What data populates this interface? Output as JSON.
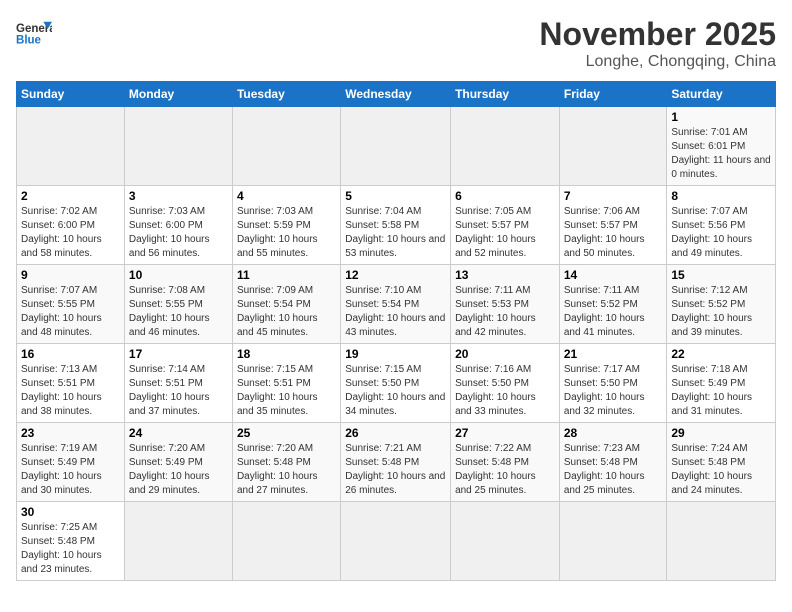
{
  "header": {
    "title": "November 2025",
    "location": "Longhe, Chongqing, China"
  },
  "calendar": {
    "headers": [
      "Sunday",
      "Monday",
      "Tuesday",
      "Wednesday",
      "Thursday",
      "Friday",
      "Saturday"
    ],
    "rows": [
      [
        {
          "day": "",
          "info": ""
        },
        {
          "day": "",
          "info": ""
        },
        {
          "day": "",
          "info": ""
        },
        {
          "day": "",
          "info": ""
        },
        {
          "day": "",
          "info": ""
        },
        {
          "day": "",
          "info": ""
        },
        {
          "day": "1",
          "info": "Sunrise: 7:01 AM\nSunset: 6:01 PM\nDaylight: 11 hours and 0 minutes."
        }
      ],
      [
        {
          "day": "2",
          "info": "Sunrise: 7:02 AM\nSunset: 6:00 PM\nDaylight: 10 hours and 58 minutes."
        },
        {
          "day": "3",
          "info": "Sunrise: 7:03 AM\nSunset: 6:00 PM\nDaylight: 10 hours and 56 minutes."
        },
        {
          "day": "4",
          "info": "Sunrise: 7:03 AM\nSunset: 5:59 PM\nDaylight: 10 hours and 55 minutes."
        },
        {
          "day": "5",
          "info": "Sunrise: 7:04 AM\nSunset: 5:58 PM\nDaylight: 10 hours and 53 minutes."
        },
        {
          "day": "6",
          "info": "Sunrise: 7:05 AM\nSunset: 5:57 PM\nDaylight: 10 hours and 52 minutes."
        },
        {
          "day": "7",
          "info": "Sunrise: 7:06 AM\nSunset: 5:57 PM\nDaylight: 10 hours and 50 minutes."
        },
        {
          "day": "8",
          "info": "Sunrise: 7:07 AM\nSunset: 5:56 PM\nDaylight: 10 hours and 49 minutes."
        }
      ],
      [
        {
          "day": "9",
          "info": "Sunrise: 7:07 AM\nSunset: 5:55 PM\nDaylight: 10 hours and 48 minutes."
        },
        {
          "day": "10",
          "info": "Sunrise: 7:08 AM\nSunset: 5:55 PM\nDaylight: 10 hours and 46 minutes."
        },
        {
          "day": "11",
          "info": "Sunrise: 7:09 AM\nSunset: 5:54 PM\nDaylight: 10 hours and 45 minutes."
        },
        {
          "day": "12",
          "info": "Sunrise: 7:10 AM\nSunset: 5:54 PM\nDaylight: 10 hours and 43 minutes."
        },
        {
          "day": "13",
          "info": "Sunrise: 7:11 AM\nSunset: 5:53 PM\nDaylight: 10 hours and 42 minutes."
        },
        {
          "day": "14",
          "info": "Sunrise: 7:11 AM\nSunset: 5:52 PM\nDaylight: 10 hours and 41 minutes."
        },
        {
          "day": "15",
          "info": "Sunrise: 7:12 AM\nSunset: 5:52 PM\nDaylight: 10 hours and 39 minutes."
        }
      ],
      [
        {
          "day": "16",
          "info": "Sunrise: 7:13 AM\nSunset: 5:51 PM\nDaylight: 10 hours and 38 minutes."
        },
        {
          "day": "17",
          "info": "Sunrise: 7:14 AM\nSunset: 5:51 PM\nDaylight: 10 hours and 37 minutes."
        },
        {
          "day": "18",
          "info": "Sunrise: 7:15 AM\nSunset: 5:51 PM\nDaylight: 10 hours and 35 minutes."
        },
        {
          "day": "19",
          "info": "Sunrise: 7:15 AM\nSunset: 5:50 PM\nDaylight: 10 hours and 34 minutes."
        },
        {
          "day": "20",
          "info": "Sunrise: 7:16 AM\nSunset: 5:50 PM\nDaylight: 10 hours and 33 minutes."
        },
        {
          "day": "21",
          "info": "Sunrise: 7:17 AM\nSunset: 5:50 PM\nDaylight: 10 hours and 32 minutes."
        },
        {
          "day": "22",
          "info": "Sunrise: 7:18 AM\nSunset: 5:49 PM\nDaylight: 10 hours and 31 minutes."
        }
      ],
      [
        {
          "day": "23",
          "info": "Sunrise: 7:19 AM\nSunset: 5:49 PM\nDaylight: 10 hours and 30 minutes."
        },
        {
          "day": "24",
          "info": "Sunrise: 7:20 AM\nSunset: 5:49 PM\nDaylight: 10 hours and 29 minutes."
        },
        {
          "day": "25",
          "info": "Sunrise: 7:20 AM\nSunset: 5:48 PM\nDaylight: 10 hours and 27 minutes."
        },
        {
          "day": "26",
          "info": "Sunrise: 7:21 AM\nSunset: 5:48 PM\nDaylight: 10 hours and 26 minutes."
        },
        {
          "day": "27",
          "info": "Sunrise: 7:22 AM\nSunset: 5:48 PM\nDaylight: 10 hours and 25 minutes."
        },
        {
          "day": "28",
          "info": "Sunrise: 7:23 AM\nSunset: 5:48 PM\nDaylight: 10 hours and 25 minutes."
        },
        {
          "day": "29",
          "info": "Sunrise: 7:24 AM\nSunset: 5:48 PM\nDaylight: 10 hours and 24 minutes."
        }
      ],
      [
        {
          "day": "30",
          "info": "Sunrise: 7:25 AM\nSunset: 5:48 PM\nDaylight: 10 hours and 23 minutes."
        },
        {
          "day": "",
          "info": ""
        },
        {
          "day": "",
          "info": ""
        },
        {
          "day": "",
          "info": ""
        },
        {
          "day": "",
          "info": ""
        },
        {
          "day": "",
          "info": ""
        },
        {
          "day": "",
          "info": ""
        }
      ]
    ]
  }
}
